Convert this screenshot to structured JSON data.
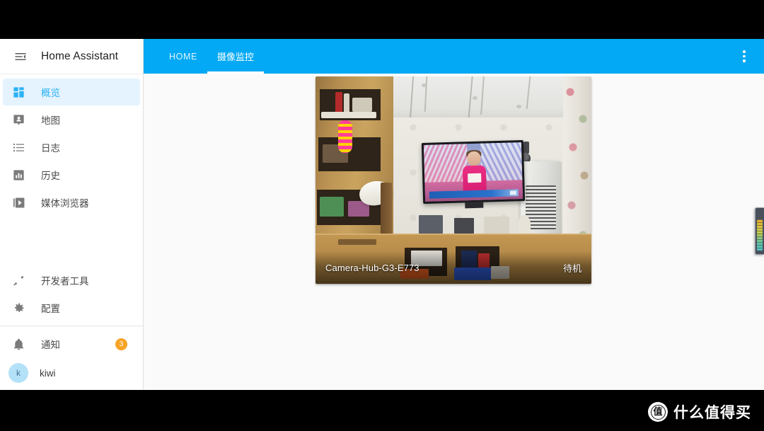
{
  "app": {
    "title": "Home Assistant",
    "accent_color": "#03a9f4",
    "active_nav_bg": "#e4f3fd",
    "badge_color": "#f7a325",
    "content_bg": "#fafafa"
  },
  "sidebar": {
    "menu_icon": "menu-collapse-icon",
    "title": "Home Assistant",
    "items": [
      {
        "label": "概览",
        "icon": "view-dashboard-icon",
        "active": true
      },
      {
        "label": "地图",
        "icon": "map-marker-account-icon",
        "active": false
      },
      {
        "label": "日志",
        "icon": "format-list-bulleted-icon",
        "active": false
      },
      {
        "label": "历史",
        "icon": "chart-box-icon",
        "active": false
      },
      {
        "label": "媒体浏览器",
        "icon": "play-box-multiple-icon",
        "active": false
      }
    ],
    "lower_items": [
      {
        "label": "开发者工具",
        "icon": "hammer-wrench-icon"
      },
      {
        "label": "配置",
        "icon": "cog-icon"
      }
    ],
    "notifications": {
      "label": "通知",
      "icon": "bell-icon",
      "count": "3"
    },
    "user": {
      "name": "kiwi",
      "avatar_initial": "k"
    }
  },
  "toolbar": {
    "tabs": [
      {
        "label": "HOME",
        "active": false
      },
      {
        "label": "摄像监控",
        "active": true
      }
    ],
    "overflow_icon": "dots-vertical-icon"
  },
  "camera_card": {
    "name": "Camera-Hub-G3-E773",
    "status": "待机",
    "scene_description": "living-room-camera-snapshot"
  },
  "edge_widget": {
    "name": "color-scale-bar"
  },
  "watermark": {
    "logo_char": "值",
    "text": "什么值得买"
  }
}
